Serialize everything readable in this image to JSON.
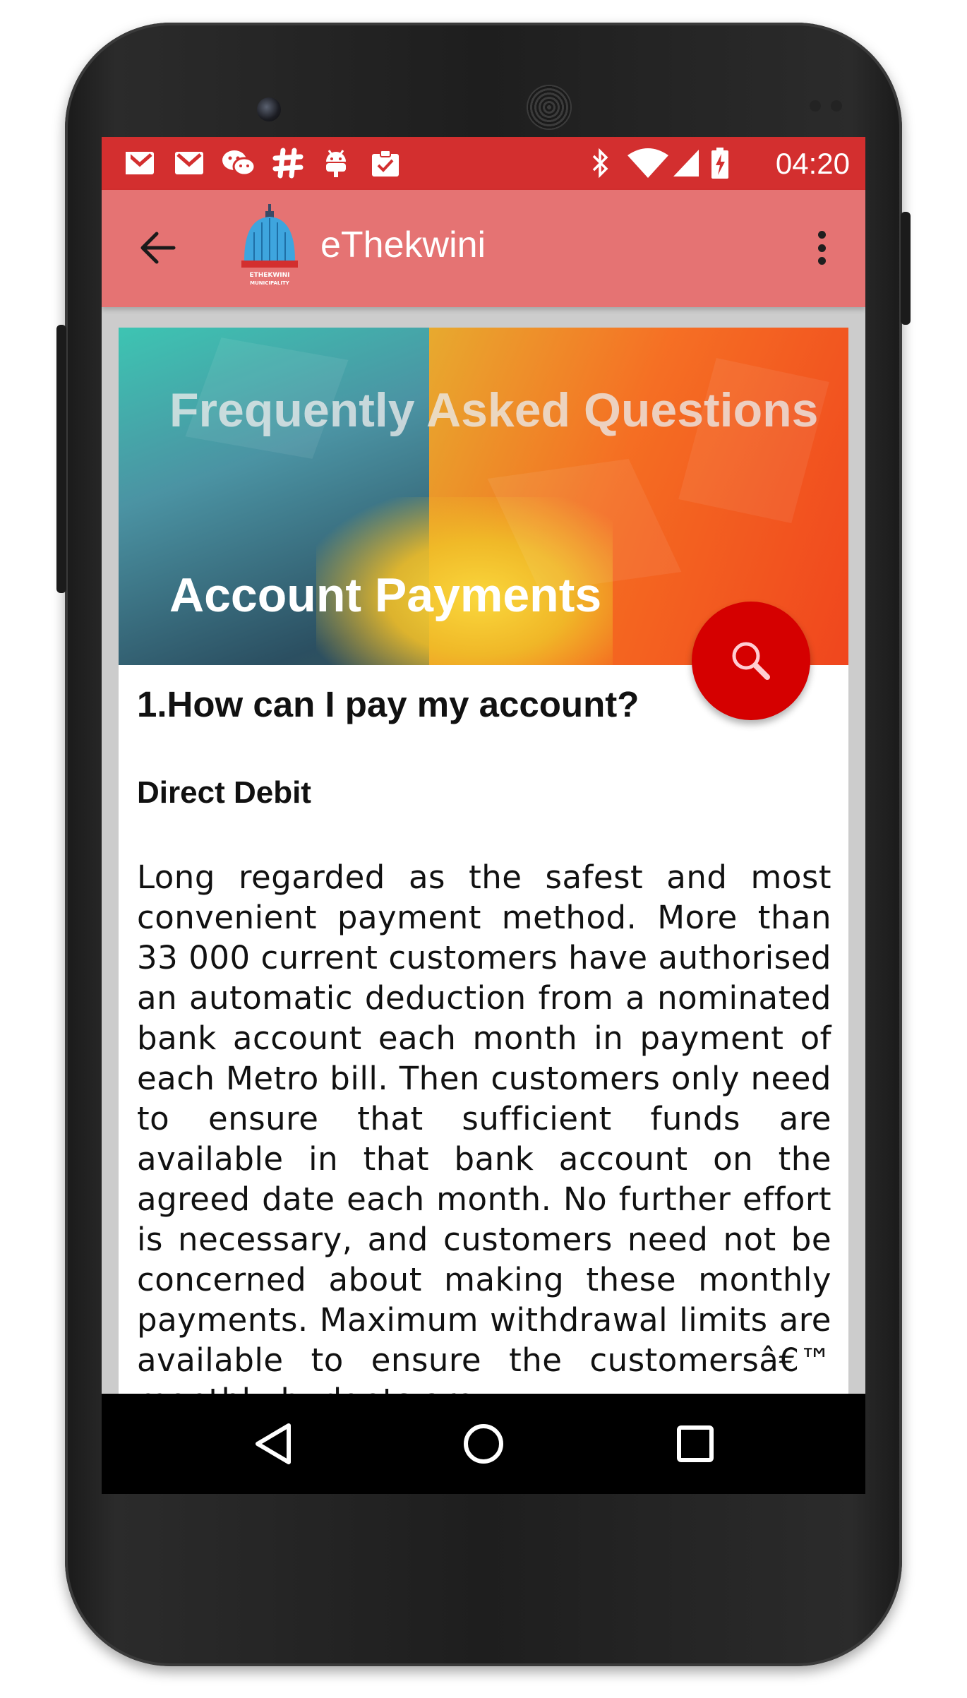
{
  "status_bar": {
    "time": "04:20",
    "left_icons": [
      "gmail-icon",
      "gmail-icon",
      "wechat-icon",
      "slack-icon",
      "android-icon",
      "clipboard-check-icon"
    ],
    "right_icons": [
      "bluetooth-icon",
      "wifi-icon",
      "signal-icon",
      "battery-charging-icon"
    ]
  },
  "app_bar": {
    "title": "eThekwini",
    "logo_text": "ETHEKWINI MUNICIPALITY"
  },
  "banner": {
    "heading": "Frequently Asked Questions",
    "section": "Account Payments"
  },
  "content": {
    "question": "1.How can I pay my account?",
    "subheading": "Direct Debit",
    "paragraph": "Long regarded as the safest and most convenient payment method. More than 33 000 current customers have authorised an automatic deduction from a nominated bank account each month in payment of each Metro bill. Then customers only need to ensure that sufficient funds are available in that bank account on the agreed date each month. No further effort is necessary, and customers need not be concerned about making these monthly payments. Maximum withdrawal limits are available to ensure the customersâ€™ monthly budgets are"
  },
  "colors": {
    "status_bar": "#d32f2f",
    "app_bar": "#e57373",
    "fab": "#d50000"
  }
}
